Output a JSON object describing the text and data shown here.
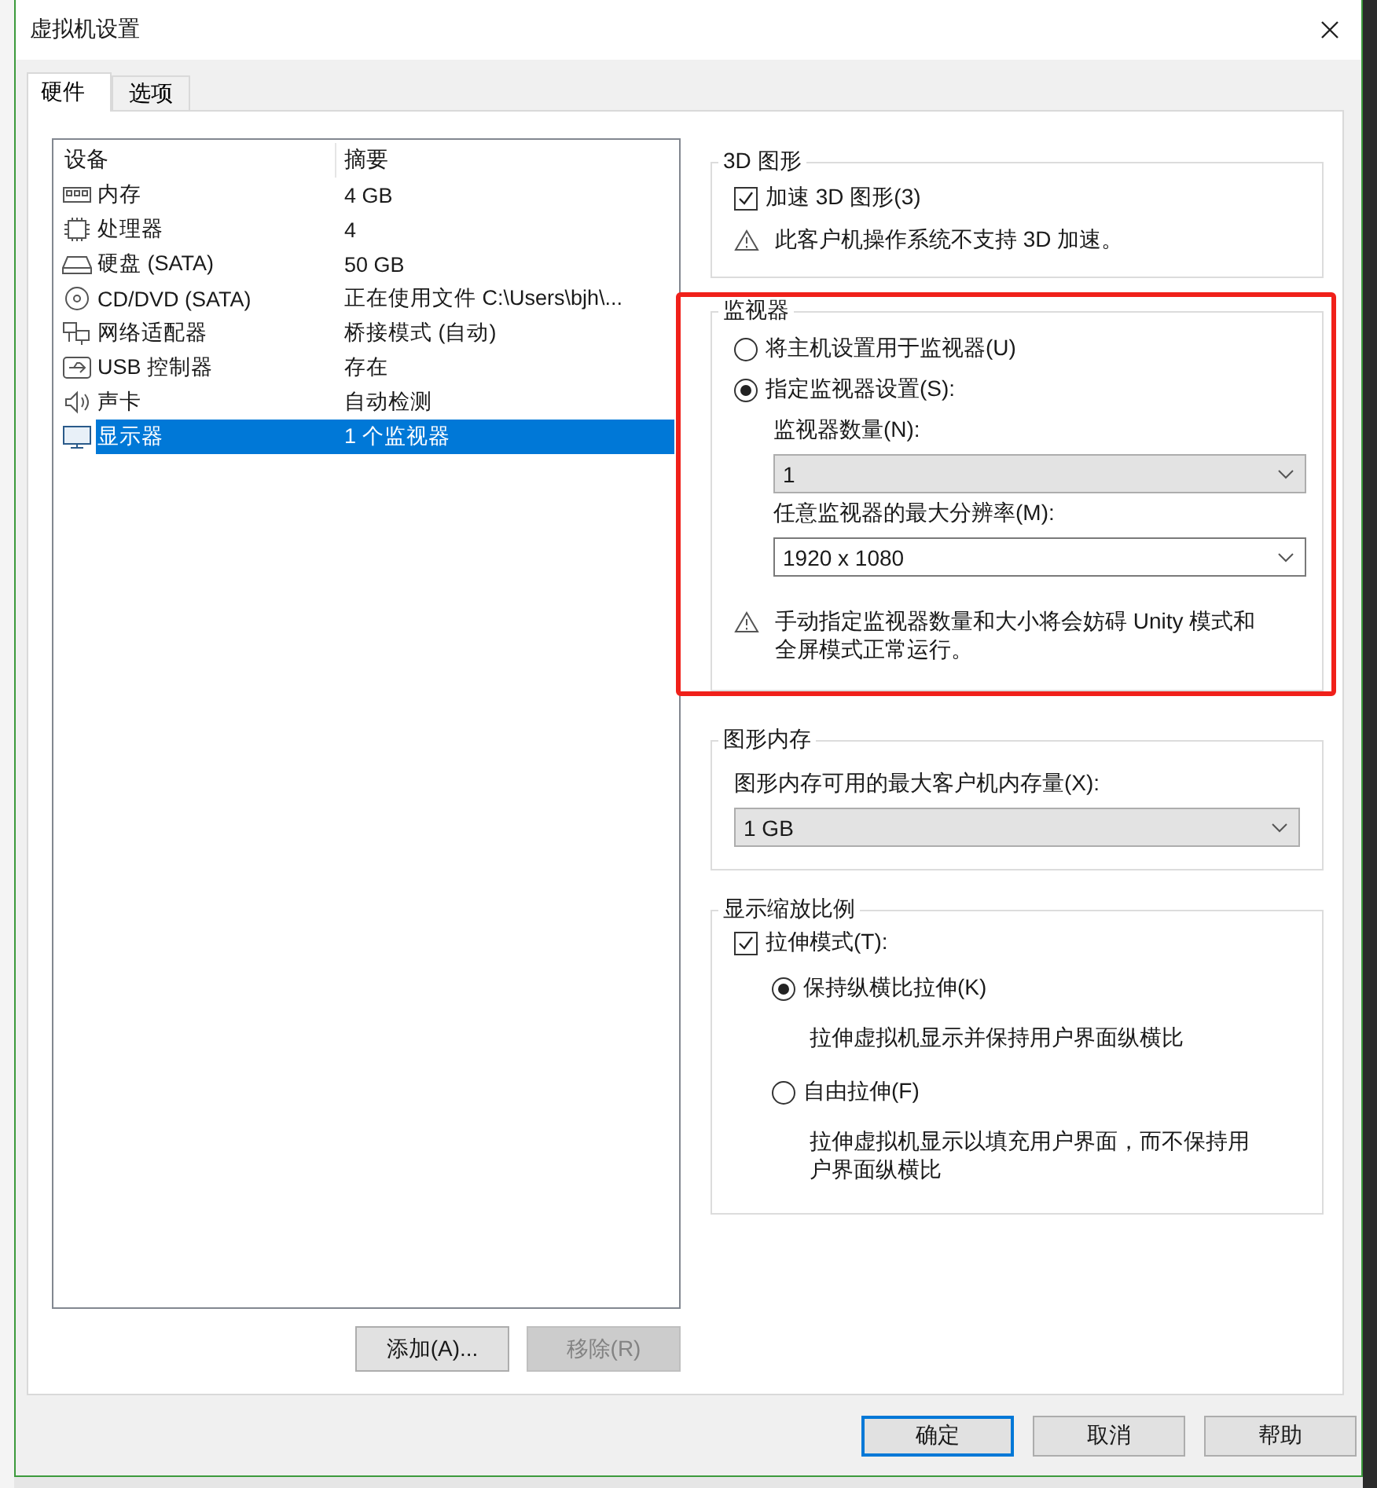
{
  "window": {
    "title": "虚拟机设置"
  },
  "tabs": [
    {
      "label": "硬件",
      "selected": true
    },
    {
      "label": "选项",
      "selected": false
    }
  ],
  "device_table": {
    "columns": [
      "设备",
      "摘要"
    ],
    "rows": [
      {
        "kind": "memory",
        "device": "内存",
        "summary": "4 GB",
        "selected": false
      },
      {
        "kind": "cpu",
        "device": "处理器",
        "summary": "4",
        "selected": false
      },
      {
        "kind": "disk",
        "device": "硬盘 (SATA)",
        "summary": "50 GB",
        "selected": false
      },
      {
        "kind": "cd",
        "device": "CD/DVD (SATA)",
        "summary": "正在使用文件 C:\\Users\\bjh\\...",
        "selected": false
      },
      {
        "kind": "network",
        "device": "网络适配器",
        "summary": "桥接模式 (自动)",
        "selected": false
      },
      {
        "kind": "usb",
        "device": "USB 控制器",
        "summary": "存在",
        "selected": false
      },
      {
        "kind": "sound",
        "device": "声卡",
        "summary": "自动检测",
        "selected": false
      },
      {
        "kind": "display",
        "device": "显示器",
        "summary": "1 个监视器",
        "selected": true
      }
    ]
  },
  "device_buttons": [
    {
      "label": "添加(A)...",
      "disabled": false
    },
    {
      "label": "移除(R)",
      "disabled": true
    }
  ],
  "graphics_3d": {
    "title": "3D 图形",
    "accelerate": {
      "label": "加速 3D 图形(3)",
      "checked": true
    },
    "warning": "此客户机操作系统不支持 3D 加速。"
  },
  "monitors": {
    "title": "监视器",
    "highlighted": true,
    "options": [
      {
        "label": "将主机设置用于监视器(U)",
        "selected": false
      },
      {
        "label": "指定监视器设置(S):",
        "selected": true
      }
    ],
    "count_label": "监视器数量(N):",
    "count": {
      "value": "1",
      "editable": false
    },
    "resolution_label": "任意监视器的最大分辨率(M):",
    "resolution": {
      "value": "1920 x 1080",
      "editable": true
    },
    "warning": "手动指定监视器数量和大小将会妨碍 Unity 模式和全屏模式正常运行。"
  },
  "graphics_memory": {
    "title": "图形内存",
    "label": "图形内存可用的最大客户机内存量(X):",
    "select": {
      "value": "1 GB",
      "editable": false
    }
  },
  "scaling": {
    "title": "显示缩放比例",
    "stretch": {
      "label": "拉伸模式(T):",
      "checked": true
    },
    "options": [
      {
        "label": "保持纵横比拉伸(K)",
        "description": "拉伸虚拟机显示并保持用户界面纵横比",
        "selected": true
      },
      {
        "label": "自由拉伸(F)",
        "description": "拉伸虚拟机显示以填充用户界面，而不保持用户界面纵横比",
        "selected": false
      }
    ]
  },
  "dialog_buttons": [
    {
      "label": "确定",
      "default": true
    },
    {
      "label": "取消",
      "default": false
    },
    {
      "label": "帮助",
      "default": false
    }
  ]
}
